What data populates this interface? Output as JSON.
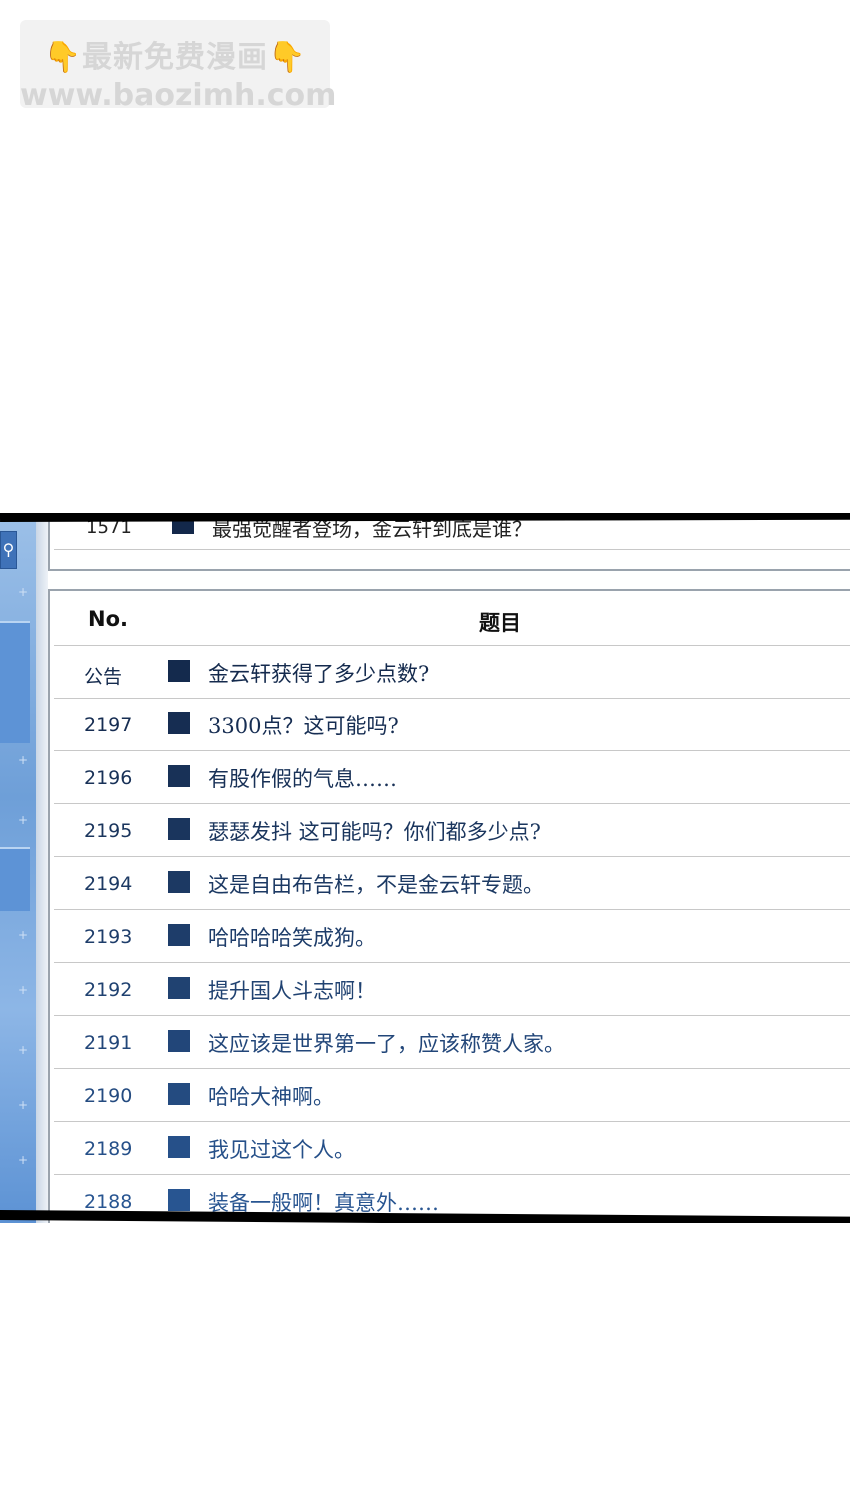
{
  "watermark": {
    "line1": "最新免费漫画",
    "line2": "www.baozimh.com"
  },
  "board": {
    "previous_post": {
      "no": "1571",
      "title": "最强觉醒者登场，金云轩到底是谁？"
    },
    "columns": {
      "no": "No.",
      "title": "题目"
    },
    "posts": [
      {
        "no": "公告",
        "title": "金云轩获得了多少点数?",
        "color": "#142a4d"
      },
      {
        "no": "2197",
        "title": "3300点？这可能吗?",
        "color": "#162d52"
      },
      {
        "no": "2196",
        "title": "有股作假的气息……",
        "color": "#183157"
      },
      {
        "no": "2195",
        "title": "瑟瑟发抖 这可能吗？你们都多少点?",
        "color": "#1a355d"
      },
      {
        "no": "2194",
        "title": "这是自由布告栏，不是金云轩专题。",
        "color": "#1c3963"
      },
      {
        "no": "2193",
        "title": "哈哈哈哈笑成狗。",
        "color": "#1e3d6a"
      },
      {
        "no": "2192",
        "title": "提升国人斗志啊！",
        "color": "#204271"
      },
      {
        "no": "2191",
        "title": "这应该是世界第一了，应该称赞人家。",
        "color": "#224679"
      },
      {
        "no": "2190",
        "title": "哈哈大神啊。",
        "color": "#244b80"
      },
      {
        "no": "2189",
        "title": "我见过这个人。",
        "color": "#265089"
      },
      {
        "no": "2188",
        "title": "装备一般啊！真意外……",
        "color": "#285591"
      }
    ]
  }
}
